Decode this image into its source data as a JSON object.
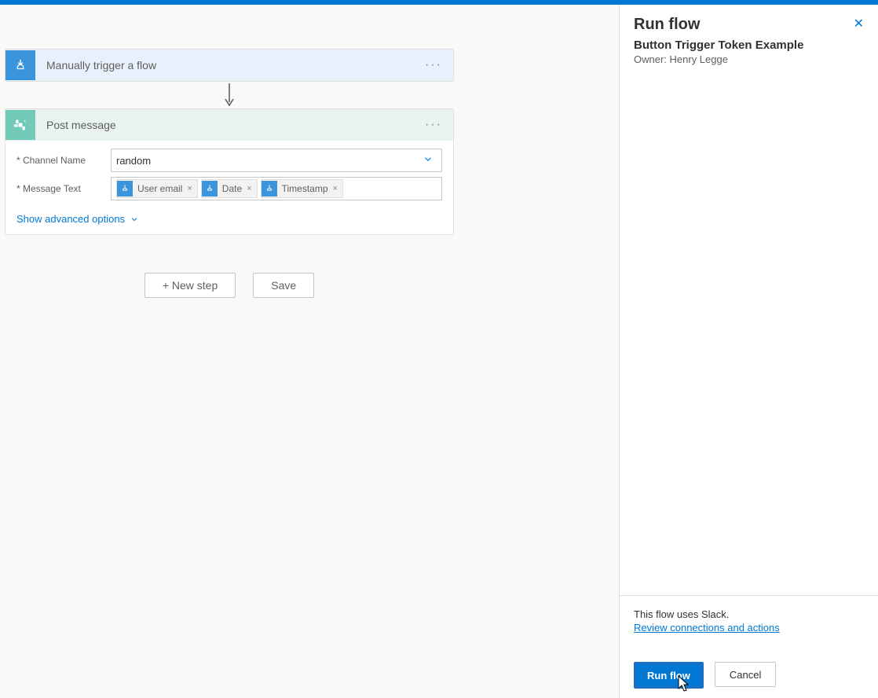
{
  "trigger": {
    "title": "Manually trigger a flow"
  },
  "action": {
    "title": "Post message",
    "fields": {
      "channel": {
        "label": "* Channel Name",
        "value": "random"
      },
      "message": {
        "label": "* Message Text"
      }
    },
    "tokens": [
      "User email",
      "Date",
      "Timestamp"
    ],
    "show_advanced": "Show advanced options"
  },
  "buttons": {
    "new_step": "+ New step",
    "save": "Save"
  },
  "panel": {
    "title": "Run flow",
    "subtitle": "Button Trigger Token Example",
    "owner": "Owner: Henry Legge",
    "footer_note": "This flow uses Slack.",
    "footer_link": "Review connections and actions",
    "run": "Run flow",
    "cancel": "Cancel"
  }
}
